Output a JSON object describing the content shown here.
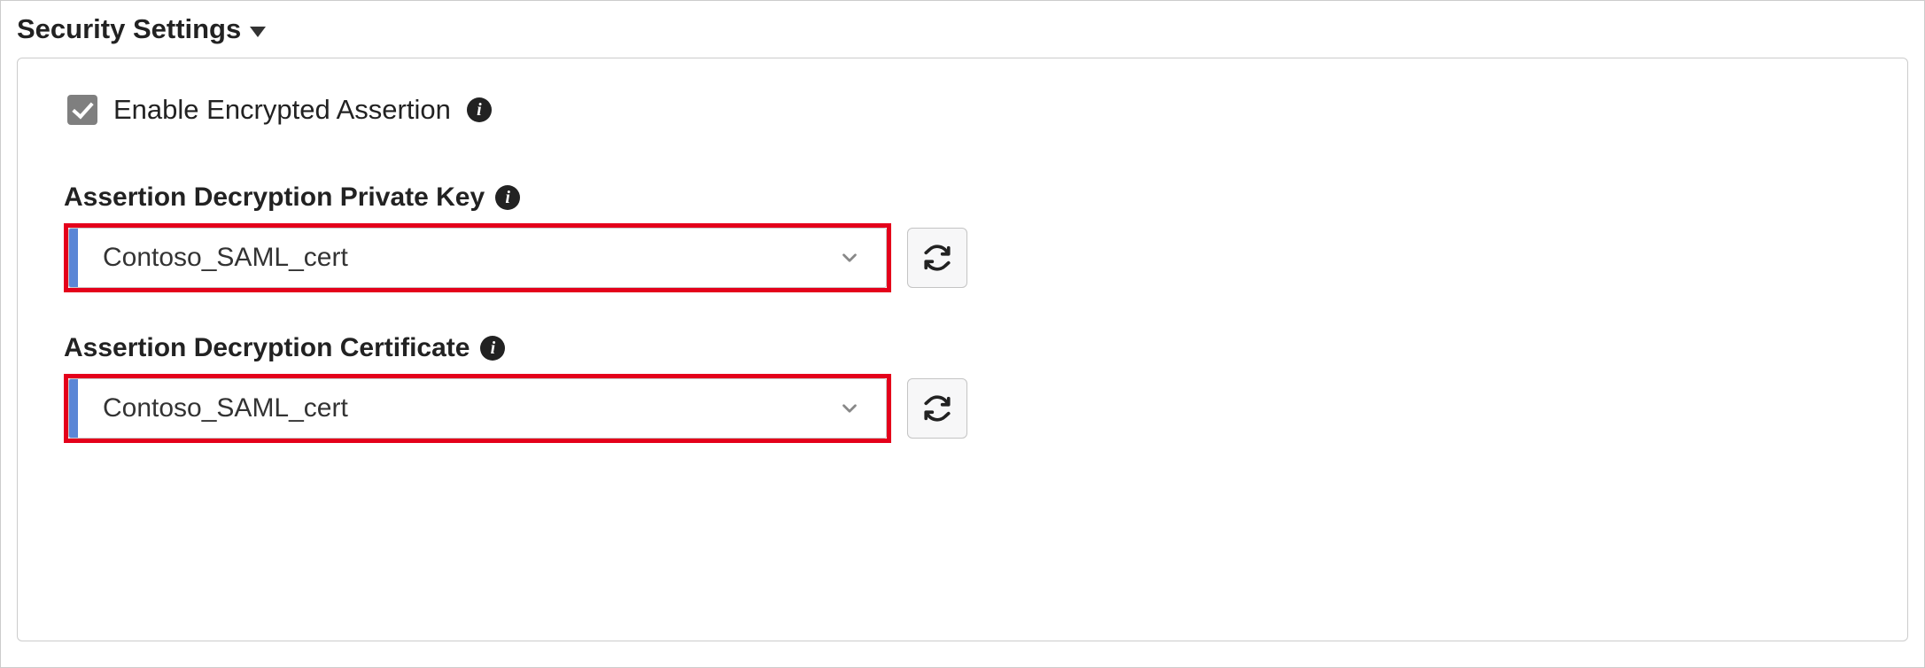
{
  "section": {
    "title": "Security Settings"
  },
  "fields": {
    "enable_encrypted": {
      "label": "Enable Encrypted Assertion",
      "checked": true
    },
    "private_key": {
      "label": "Assertion Decryption Private Key",
      "value": "Contoso_SAML_cert"
    },
    "certificate": {
      "label": "Assertion Decryption Certificate",
      "value": "Contoso_SAML_cert"
    }
  },
  "colors": {
    "highlight_border": "#e4001b",
    "dropdown_accent": "#5b86d6",
    "checkbox_bg": "#7f7f7f"
  }
}
